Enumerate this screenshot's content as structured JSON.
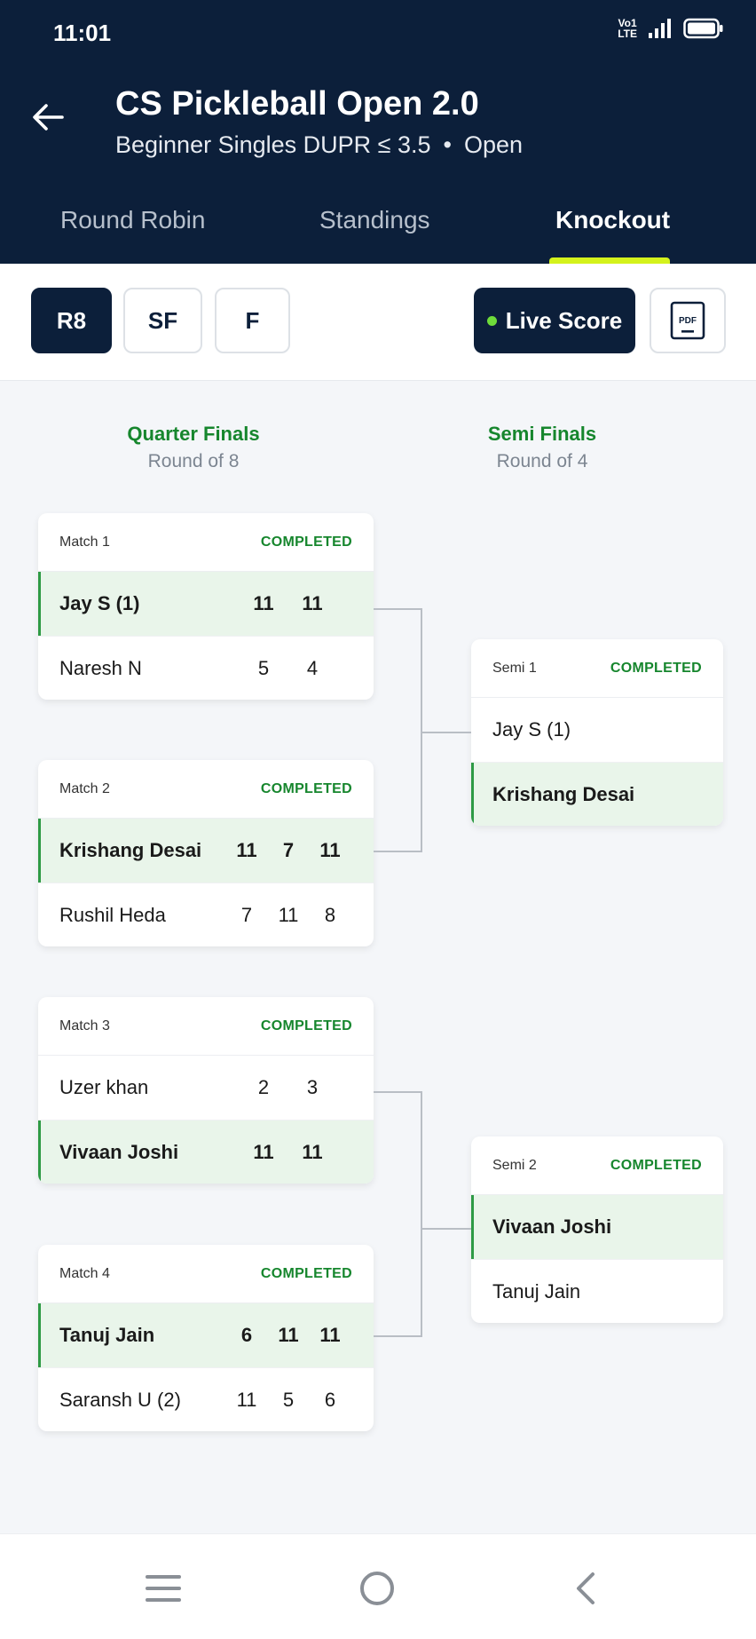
{
  "status": {
    "time": "11:01",
    "volte_line1": "Vo1",
    "volte_line2": "LTE"
  },
  "header": {
    "title": "CS Pickleball Open 2.0",
    "category": "Beginner Singles DUPR ≤ 3.5",
    "separator": "•",
    "state": "Open"
  },
  "tabs": [
    {
      "label": "Round Robin"
    },
    {
      "label": "Standings"
    },
    {
      "label": "Knockout",
      "active": true
    }
  ],
  "toolbar": {
    "rounds": [
      "R8",
      "SF",
      "F"
    ],
    "active_round": "R8",
    "live_score": "Live Score",
    "pdf": "PDF"
  },
  "columns": {
    "qf_title": "Quarter Finals",
    "qf_sub": "Round of 8",
    "sf_title": "Semi Finals",
    "sf_sub": "Round of 4"
  },
  "matches": [
    {
      "label": "Match 1",
      "status": "COMPLETED",
      "p1": {
        "name": "Jay S (1)",
        "scores": [
          "11",
          "11"
        ],
        "win": true
      },
      "p2": {
        "name": "Naresh N",
        "scores": [
          "5",
          "4"
        ],
        "win": false
      }
    },
    {
      "label": "Match 2",
      "status": "COMPLETED",
      "p1": {
        "name": "Krishang Desai",
        "scores": [
          "11",
          "7",
          "11"
        ],
        "win": true
      },
      "p2": {
        "name": "Rushil Heda",
        "scores": [
          "7",
          "11",
          "8"
        ],
        "win": false
      }
    },
    {
      "label": "Match 3",
      "status": "COMPLETED",
      "p1": {
        "name": "Uzer khan",
        "scores": [
          "2",
          "3"
        ],
        "win": false
      },
      "p2": {
        "name": "Vivaan Joshi",
        "scores": [
          "11",
          "11"
        ],
        "win": true
      }
    },
    {
      "label": "Match 4",
      "status": "COMPLETED",
      "p1": {
        "name": "Tanuj Jain",
        "scores": [
          "6",
          "11",
          "11"
        ],
        "win": true
      },
      "p2": {
        "name": "Saransh U (2)",
        "scores": [
          "11",
          "5",
          "6"
        ],
        "win": false
      }
    }
  ],
  "semis": [
    {
      "label": "Semi 1",
      "status": "COMPLETED",
      "p1": {
        "name": "Jay S (1)",
        "win": false
      },
      "p2": {
        "name": "Krishang Desai",
        "win": true
      }
    },
    {
      "label": "Semi 2",
      "status": "COMPLETED",
      "p1": {
        "name": "Vivaan Joshi",
        "win": true
      },
      "p2": {
        "name": "Tanuj Jain",
        "win": false
      }
    }
  ],
  "colors": {
    "navy": "#0c1f3a",
    "accent": "#d4f21c",
    "green": "#16862d",
    "win_bg": "#e9f5ea",
    "live_dot": "#6fdc3a"
  },
  "icons": {
    "back": "arrow-left-icon",
    "pdf": "pdf-icon",
    "menu": "menu-icon",
    "home": "home-circle-icon",
    "nav_back": "chevron-left-icon"
  }
}
